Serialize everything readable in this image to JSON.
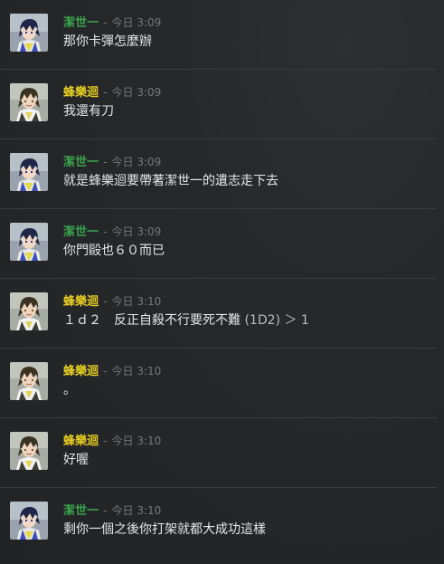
{
  "users": {
    "a": {
      "name": "潔世一",
      "color": "#3aa24c",
      "avatar": "blue-hair-boy-avatar"
    },
    "b": {
      "name": "蜂樂迴",
      "color": "#e9cf22",
      "avatar": "dark-hair-boy-avatar"
    }
  },
  "separator": "-",
  "messages": [
    {
      "user": "a",
      "name": "潔世一",
      "time": "今日 3:09",
      "text": "那你卡彈怎麼辦"
    },
    {
      "user": "b",
      "name": "蜂樂迴",
      "time": "今日 3:09",
      "text": "我還有刀"
    },
    {
      "user": "a",
      "name": "潔世一",
      "time": "今日 3:09",
      "text": "就是蜂樂迴要帶著潔世一的遺志走下去"
    },
    {
      "user": "a",
      "name": "潔世一",
      "time": "今日 3:09",
      "text": "你門毆也６０而已"
    },
    {
      "user": "b",
      "name": "蜂樂迴",
      "time": "今日 3:10",
      "text": "１ｄ２　反正自殺不行要死不難",
      "roll": " (1D2) ＞ 1"
    },
    {
      "user": "b",
      "name": "蜂樂迴",
      "time": "今日 3:10",
      "text": "。"
    },
    {
      "user": "b",
      "name": "蜂樂迴",
      "time": "今日 3:10",
      "text": "好喔"
    },
    {
      "user": "a",
      "name": "潔世一",
      "time": "今日 3:10",
      "text": "剩你一個之後你打架就都大成功這樣"
    }
  ]
}
